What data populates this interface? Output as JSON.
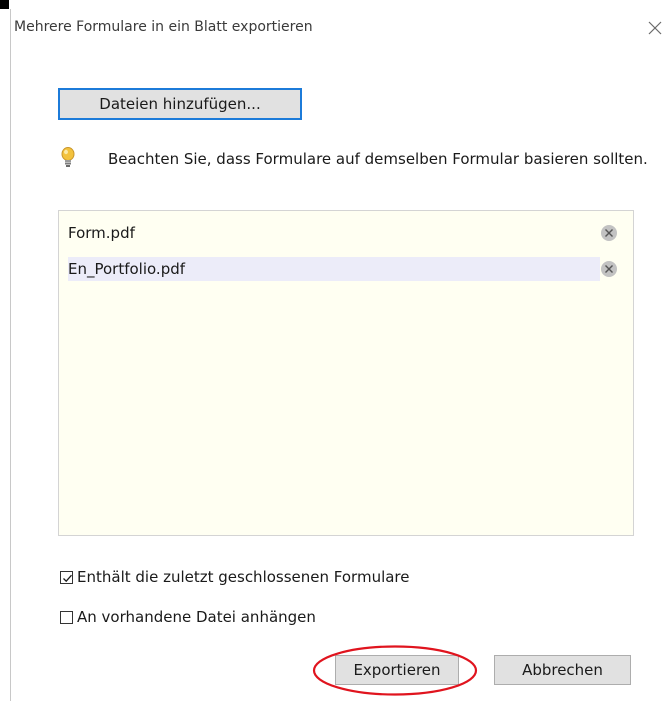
{
  "window": {
    "title": "Mehrere Formulare in ein Blatt exportieren",
    "close_icon": "close-icon"
  },
  "add_files_label": "Dateien hinzufügen...",
  "hint": {
    "icon": "lightbulb-icon",
    "text": "Beachten Sie, dass Formulare auf demselben Formular basieren sollten."
  },
  "files": [
    {
      "name": "Form.pdf",
      "selected": false,
      "remove_icon": "remove-circle-icon"
    },
    {
      "name": "En_Portfolio.pdf",
      "selected": true,
      "remove_icon": "remove-circle-icon"
    }
  ],
  "options": [
    {
      "label": "Enthält die zuletzt geschlossenen Formulare",
      "checked": true
    },
    {
      "label": "An vorhandene Datei anhängen",
      "checked": false
    }
  ],
  "buttons": {
    "export_label": "Exportieren",
    "cancel_label": "Abbrechen"
  },
  "colors": {
    "list_background": "#fffff2",
    "selected_row": "#ececf9",
    "focus_border": "#1c7bd9",
    "annotation_red": "#e0141e"
  }
}
